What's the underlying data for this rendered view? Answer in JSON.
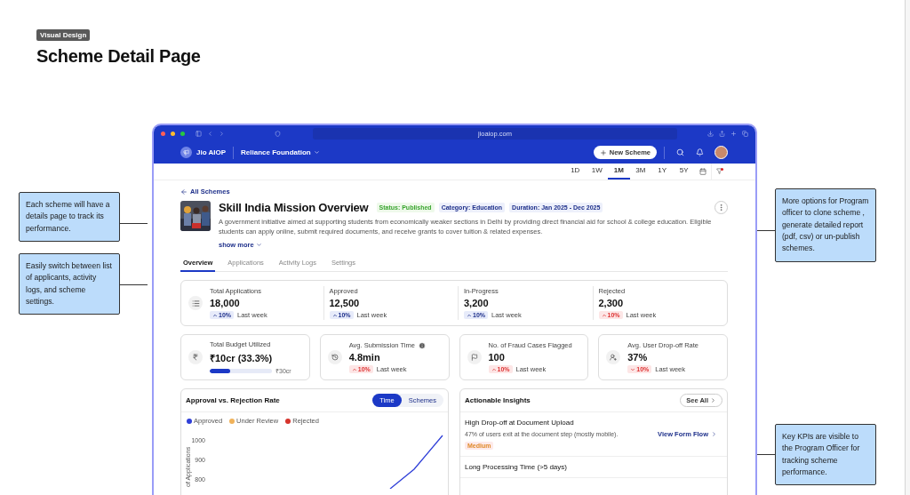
{
  "canvas": {
    "tag": "Visual Design",
    "title": "Scheme Detail Page"
  },
  "annotations": [
    {
      "text": "Each scheme will have a details page to track its performance."
    },
    {
      "text": "Easily switch between list of applicants, activity logs, and scheme settings."
    },
    {
      "text": "More options for Program officer to clone scheme , generate detailed report (pdf, csv) or un-publish schemes."
    },
    {
      "text": "Key KPIs are visible to the Program Officer for tracking scheme performance."
    }
  ],
  "browser": {
    "url": "jioaiop.com"
  },
  "header": {
    "brand": "Jio AIOP",
    "organization": "Reliance Foundation",
    "new_button": "New Scheme"
  },
  "time_ranges": [
    {
      "label": "1D",
      "selected": false
    },
    {
      "label": "1W",
      "selected": false
    },
    {
      "label": "1M",
      "selected": true
    },
    {
      "label": "3M",
      "selected": false
    },
    {
      "label": "1Y",
      "selected": false
    },
    {
      "label": "5Y",
      "selected": false
    }
  ],
  "back_link": "All Schemes",
  "scheme": {
    "title": "Skill India Mission Overview",
    "badges": [
      {
        "text": "Status: Published",
        "kind": "status"
      },
      {
        "text": "Category: Education",
        "kind": "info"
      },
      {
        "text": "Duration: Jan 2025 - Dec 2025",
        "kind": "info"
      }
    ],
    "description": "A government initiative aimed at supporting students from economically weaker sections in Delhi by providing direct financial aid for school & college education. Eligible students can apply online, submit required documents, and receive grants to cover tuition & related expenses.",
    "show_more": "show more"
  },
  "tabs": [
    {
      "label": "Overview",
      "selected": true
    },
    {
      "label": "Applications",
      "selected": false
    },
    {
      "label": "Activity Logs",
      "selected": false
    },
    {
      "label": "Settings",
      "selected": false
    }
  ],
  "summary": [
    {
      "label": "Total Applications",
      "value": "18,000",
      "change": "10%",
      "rising": true,
      "adverse": false,
      "period": "Last week"
    },
    {
      "label": "Approved",
      "value": "12,500",
      "change": "10%",
      "rising": true,
      "adverse": false,
      "period": "Last week"
    },
    {
      "label": "In-Progress",
      "value": "3,200",
      "change": "10%",
      "rising": true,
      "adverse": false,
      "period": "Last week"
    },
    {
      "label": "Rejected",
      "value": "2,300",
      "change": "10%",
      "rising": true,
      "adverse": true,
      "period": "Last week"
    }
  ],
  "kpis": [
    {
      "kind": "budget",
      "label": "Total Budget Utilized",
      "value": "₹10cr (33.3%)",
      "level": 0.333,
      "max_label": "₹30cr"
    },
    {
      "kind": "metric",
      "label": "Avg. Submission Time",
      "info": true,
      "value": "4.8min",
      "change": "10%",
      "rising": true,
      "adverse": true,
      "period": "Last week"
    },
    {
      "kind": "metric",
      "label": "No. of Fraud Cases Flagged",
      "info": false,
      "value": "100",
      "change": "10%",
      "rising": true,
      "adverse": true,
      "period": "Last week"
    },
    {
      "kind": "metric",
      "label": "Avg. User Drop-off Rate",
      "info": false,
      "value": "37%",
      "change": "10%",
      "rising": false,
      "adverse": true,
      "period": "Last week"
    }
  ],
  "approval_chart": {
    "title": "Approval vs. Rejection Rate",
    "toggles": [
      {
        "label": "Time",
        "selected": true
      },
      {
        "label": "Schemes",
        "selected": false
      }
    ],
    "legend": [
      {
        "name": "Approved",
        "color": "#2f3fd8"
      },
      {
        "name": "Under Review",
        "color": "#f0b25a"
      },
      {
        "name": "Rejected",
        "color": "#d6342c"
      }
    ],
    "axis_title": "of Applications",
    "axis_ticks": [
      "1000",
      "900",
      "800"
    ]
  },
  "insights": {
    "title": "Actionable Insights",
    "see_all": "See All",
    "items": [
      {
        "title": "High Drop-off at Document Upload",
        "detail": "47% of users exit at the document step (mostly mobile).",
        "severity": "Medium",
        "action": "View Form Flow"
      },
      {
        "title": "Long Processing Time (>5 days)"
      }
    ]
  }
}
